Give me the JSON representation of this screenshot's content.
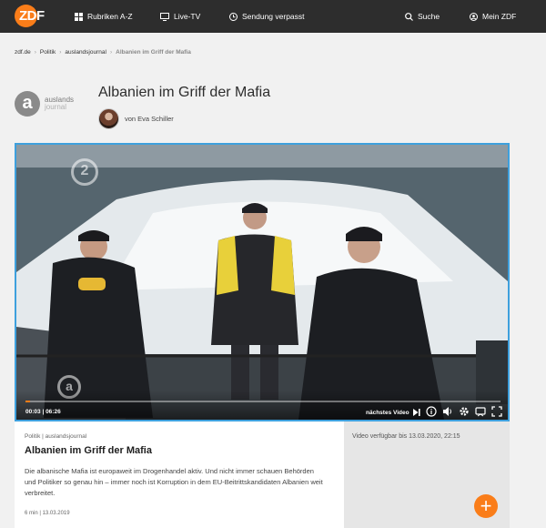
{
  "nav": {
    "logo": "ZDF",
    "items": [
      {
        "label": "Rubriken A-Z",
        "icon": "grid-icon"
      },
      {
        "label": "Live-TV",
        "icon": "tv-icon"
      },
      {
        "label": "Sendung verpasst",
        "icon": "clock-icon"
      },
      {
        "label": "Suche",
        "icon": "search-icon"
      },
      {
        "label": "Mein ZDF",
        "icon": "user-icon"
      }
    ]
  },
  "breadcrumb": [
    "zdf.de",
    "Politik",
    "auslandsjournal",
    "Albanien im Griff der Mafia"
  ],
  "brand": {
    "logo_letter": "a",
    "line1": "auslands",
    "line2": "journal"
  },
  "page": {
    "title": "Albanien im Griff der Mafia",
    "author": "von Eva Schiller"
  },
  "video": {
    "watermark": "2",
    "time_current": "00:03",
    "time_total": "06:26",
    "progress": 0.01,
    "next_label": "nächstes Video"
  },
  "info": {
    "category": "Politik | auslandsjournal",
    "title": "Albanien im Griff der Mafia",
    "description": "Die albanische Mafia ist europaweit im Drogenhandel aktiv. Und nicht immer schauen Behörden und Politiker so genau hin – immer noch ist Korruption in dem EU-Beitrittskandidaten Albanien weit verbreitet.",
    "meta": "6 min | 13.03.2019"
  },
  "side": {
    "availability": "Video verfügbar bis 13.03.2020, 22:15",
    "add_label": "+"
  },
  "colors": {
    "accent": "#fa7d19",
    "nav_bg": "#2d2d2d",
    "video_border": "#3ea0dd"
  }
}
